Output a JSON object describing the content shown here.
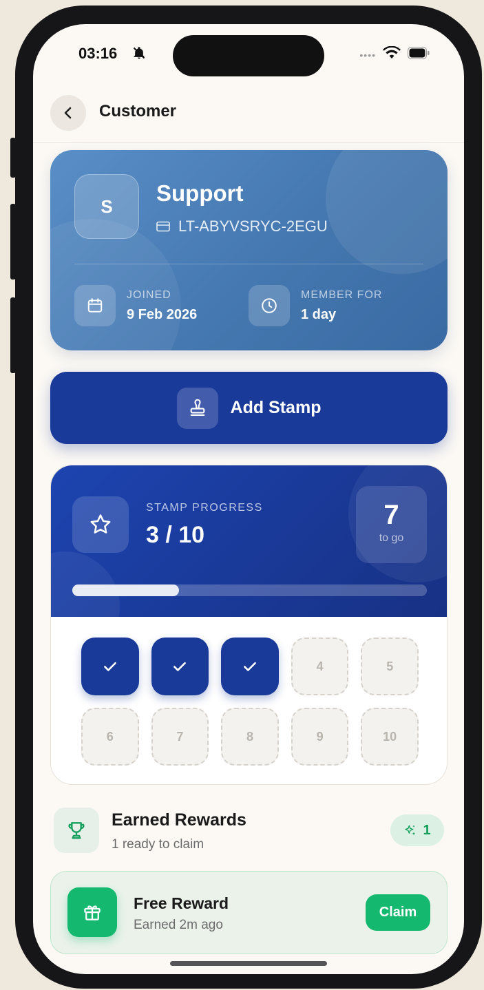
{
  "status_bar": {
    "time": "03:16"
  },
  "header": {
    "title": "Customer"
  },
  "profile": {
    "initial": "S",
    "name": "Support",
    "id": "LT-ABYVSRYC-2EGU",
    "joined_label": "JOINED",
    "joined_value": "9 Feb 2026",
    "member_label": "MEMBER FOR",
    "member_value": "1 day"
  },
  "add_stamp": {
    "label": "Add Stamp"
  },
  "progress": {
    "label": "STAMP PROGRESS",
    "count_text": "3 / 10",
    "collected": 3,
    "total": 10,
    "to_go_number": "7",
    "to_go_label": "to go",
    "bar_fraction": 0.3,
    "stamps": [
      {
        "n": "1",
        "filled": true
      },
      {
        "n": "2",
        "filled": true
      },
      {
        "n": "3",
        "filled": true
      },
      {
        "n": "4",
        "filled": false
      },
      {
        "n": "5",
        "filled": false
      },
      {
        "n": "6",
        "filled": false
      },
      {
        "n": "7",
        "filled": false
      },
      {
        "n": "8",
        "filled": false
      },
      {
        "n": "9",
        "filled": false
      },
      {
        "n": "10",
        "filled": false
      }
    ]
  },
  "rewards": {
    "title": "Earned Rewards",
    "subtitle": "1 ready to claim",
    "count_badge": "1",
    "items": [
      {
        "title": "Free Reward",
        "time": "Earned 2m ago",
        "action": "Claim"
      }
    ]
  },
  "colors": {
    "primary": "#1a3a9a",
    "profile_card": "#4578b0",
    "reward_green": "#14b96f",
    "background": "#fcf9f4"
  },
  "icons": [
    "bell-off-icon",
    "wifi-icon",
    "battery-icon",
    "back-chevron-icon",
    "card-icon",
    "calendar-icon",
    "clock-icon",
    "stamp-icon",
    "star-icon",
    "check-icon",
    "trophy-icon",
    "sparkle-icon",
    "gift-icon"
  ]
}
